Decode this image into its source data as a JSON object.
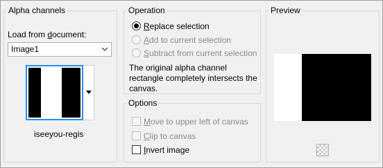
{
  "alpha_channels": {
    "title": "Alpha channels",
    "load_label_pre": "Load from ",
    "load_label_ul": "d",
    "load_label_post": "ocument:",
    "document_select_value": "Image1",
    "channel_name": "iseeyou-regis"
  },
  "operation": {
    "title": "Operation",
    "replace": {
      "ul": "R",
      "rest": "eplace selection",
      "checked": true,
      "enabled": true
    },
    "add": {
      "ul": "A",
      "rest": "dd to current selection",
      "checked": false,
      "enabled": false
    },
    "subtract": {
      "ul": "S",
      "rest": "ubtract from current selection",
      "checked": false,
      "enabled": false
    },
    "info_text": "The original alpha channel rectangle completely intersects the canvas."
  },
  "options": {
    "title": "Options",
    "move": {
      "ul": "M",
      "rest": "ove to upper left of canvas",
      "checked": false,
      "enabled": false
    },
    "clip": {
      "ul": "C",
      "rest": "lip to canvas",
      "checked": false,
      "enabled": false
    },
    "invert": {
      "ul": "I",
      "rest": "nvert image",
      "checked": false,
      "enabled": true
    }
  },
  "preview": {
    "title": "Preview",
    "background_button_icon": "checkerboard-icon"
  }
}
